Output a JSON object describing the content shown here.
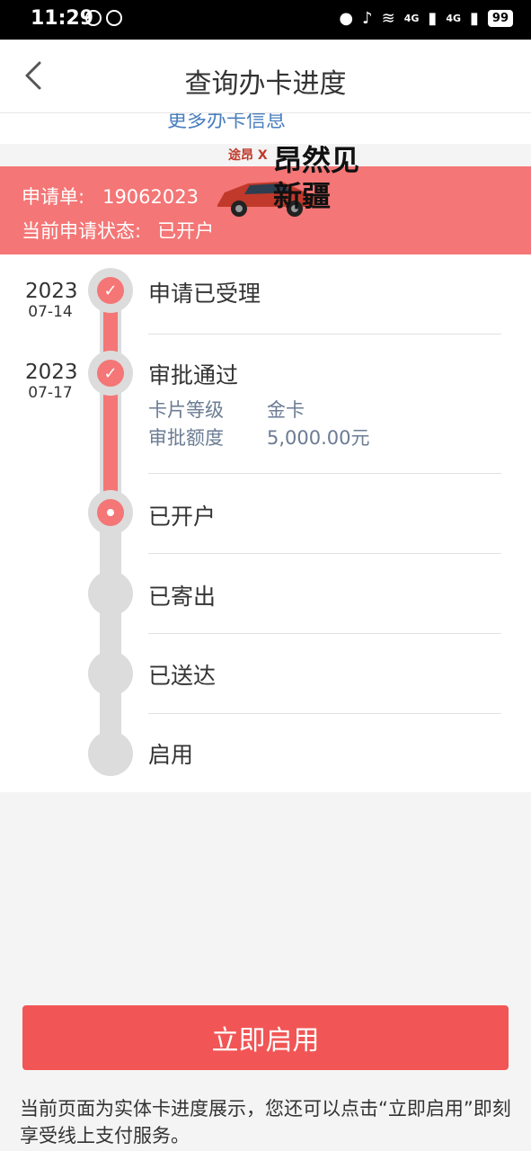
{
  "status_bar": {
    "time": "11:29",
    "network": "4G",
    "battery": "99"
  },
  "header": {
    "title": "查询办卡进度"
  },
  "more_info_link": "更多办卡信息",
  "application": {
    "number_label": "申请单:",
    "number_value": "19062023",
    "status_label": "当前申请状态:",
    "status_value": "已开户"
  },
  "ad": {
    "brand": "途昂 X",
    "slogan": "昂然见新疆"
  },
  "timeline": [
    {
      "title": "申请已受理",
      "year": "2023",
      "date": "07-14",
      "state": "done"
    },
    {
      "title": "审批通过",
      "year": "2023",
      "date": "07-17",
      "state": "done",
      "details": [
        {
          "label": "卡片等级",
          "value": "金卡"
        },
        {
          "label": "审批额度",
          "value": "5,000.00元"
        }
      ]
    },
    {
      "title": "已开户",
      "state": "current"
    },
    {
      "title": "已寄出",
      "state": "pending"
    },
    {
      "title": "已送达",
      "state": "pending"
    },
    {
      "title": "启用",
      "state": "pending"
    }
  ],
  "action": {
    "button_label": "立即启用"
  },
  "note": "当前页面为实体卡进度展示，您还可以点击“立即启用”即刻享受线上支付服务。",
  "colors": {
    "accent": "#f47676",
    "button": "#f25555",
    "link": "#4a7fbf"
  }
}
